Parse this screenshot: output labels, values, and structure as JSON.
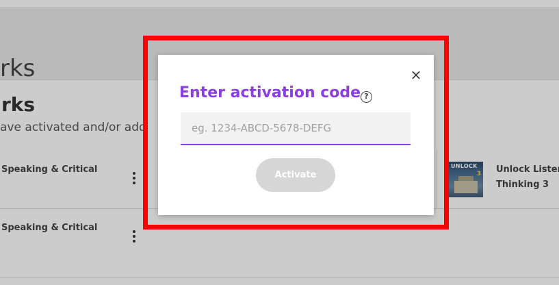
{
  "background": {
    "hero_title": "rks",
    "heading": "rks",
    "subheading": "ave activated and/or add",
    "books": [
      {
        "title": "Speaking & Critical"
      },
      {
        "title": "Speaking & Critical"
      }
    ],
    "right_book": {
      "title_line1": "Unlock Listen",
      "title_line2": "Thinking 3",
      "cover_brand": "UNLOCK",
      "cover_level": "3"
    }
  },
  "modal": {
    "title": "Enter activation code",
    "help_icon": "?",
    "close_icon": "×",
    "input": {
      "value": "",
      "placeholder": "eg. 1234-ABCD-5678-DEFG"
    },
    "activate_label": "Activate"
  },
  "colors": {
    "accent": "#8c3fe0",
    "highlight": "#ff0000",
    "disabled_button": "#d6d6d6"
  }
}
